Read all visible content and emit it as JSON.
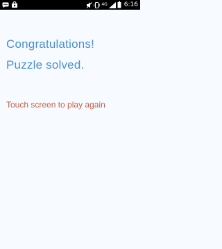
{
  "status_bar": {
    "time": "6:16",
    "network_label": "4G",
    "icons": [
      "sms-icon",
      "play-store-icon",
      "mute-icon",
      "vibrate-icon",
      "signal-icon",
      "battery-icon"
    ]
  },
  "main": {
    "title_line1": "Congratulations!",
    "title_line2": "Puzzle solved.",
    "prompt": "Touch screen to play again"
  },
  "colors": {
    "status_bar": "#000000",
    "background": "#f7fbff",
    "title": "#4a90cf",
    "prompt": "#c8604a"
  }
}
